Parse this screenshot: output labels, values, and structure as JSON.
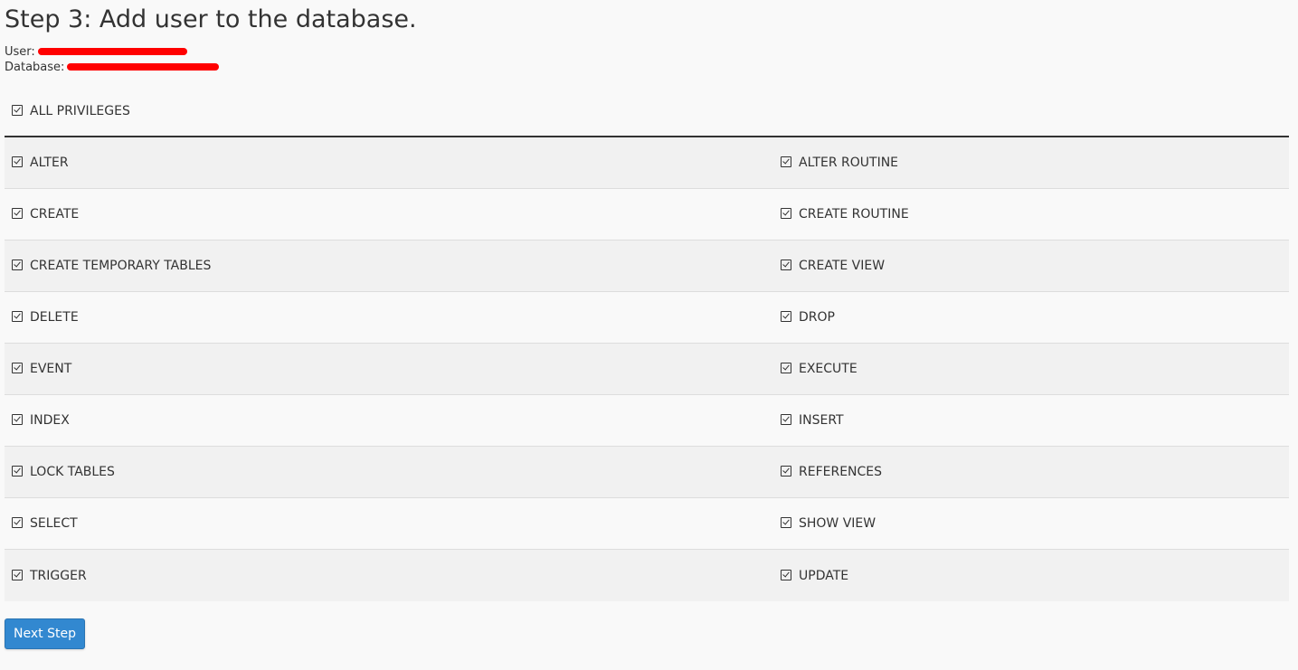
{
  "page": {
    "title": "Step 3: Add user to the database.",
    "user_label": "User:",
    "database_label": "Database:"
  },
  "all_privileges": {
    "label": "ALL PRIVILEGES",
    "checked": true
  },
  "privileges": {
    "rows": [
      {
        "left": "ALTER",
        "right": "ALTER ROUTINE"
      },
      {
        "left": "CREATE",
        "right": "CREATE ROUTINE"
      },
      {
        "left": "CREATE TEMPORARY TABLES",
        "right": "CREATE VIEW"
      },
      {
        "left": "DELETE",
        "right": "DROP"
      },
      {
        "left": "EVENT",
        "right": "EXECUTE"
      },
      {
        "left": "INDEX",
        "right": "INSERT"
      },
      {
        "left": "LOCK TABLES",
        "right": "REFERENCES"
      },
      {
        "left": "SELECT",
        "right": "SHOW VIEW"
      },
      {
        "left": "TRIGGER",
        "right": "UPDATE"
      }
    ],
    "all_checked": true
  },
  "actions": {
    "next_label": "Next Step"
  },
  "colors": {
    "button_bg": "#3288d0",
    "redaction": "#ff0000",
    "row_stripe": "#f1f1f1",
    "page_bg": "#f9f9f9"
  }
}
